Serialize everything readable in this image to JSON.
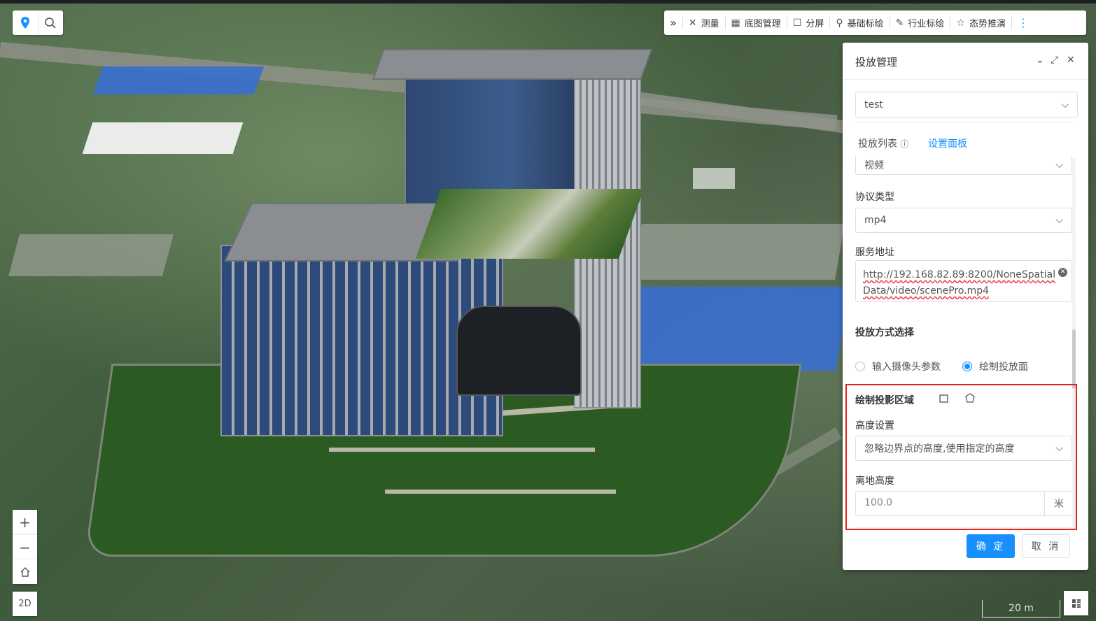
{
  "toolbar": {
    "expand_glyph": "»",
    "items": [
      {
        "label": "测量",
        "icon": "ruler-icon"
      },
      {
        "label": "底图管理",
        "icon": "grid-icon"
      },
      {
        "label": "分屏",
        "icon": "square-icon"
      },
      {
        "label": "基础标绘",
        "icon": "pin-icon"
      },
      {
        "label": "行业标绘",
        "icon": "pencil-icon"
      },
      {
        "label": "态势推演",
        "icon": "star-icon"
      }
    ],
    "more_glyph": "⋮"
  },
  "map_controls": {
    "zoom_in": "+",
    "zoom_out": "−",
    "mode_2d": "2D",
    "scale": "20 m"
  },
  "panel": {
    "title": "投放管理",
    "item_select": "test",
    "tabs": [
      "投放列表",
      "设置面板"
    ],
    "active_tab": "设置面板",
    "source_type_value": "视频",
    "protocol_label": "协议类型",
    "protocol_value": "mp4",
    "service_label": "服务地址",
    "service_value": "http://192.168.82.89:8200/NoneSpatialData/video/scenePro.mp4",
    "method_label": "投放方式选择",
    "method_options": [
      "输入摄像头参数",
      "绘制投放面"
    ],
    "method_selected": "绘制投放面",
    "draw_label": "绘制投影区域",
    "height_setting_label": "高度设置",
    "height_setting_value": "忽略边界点的高度,使用指定的高度",
    "ground_height_label": "离地高度",
    "ground_height_value": "100.0",
    "ground_height_unit": "米",
    "confirm": "确 定",
    "cancel": "取 消"
  },
  "colors": {
    "accent": "#1890ff",
    "highlight_border": "#e0241b"
  }
}
